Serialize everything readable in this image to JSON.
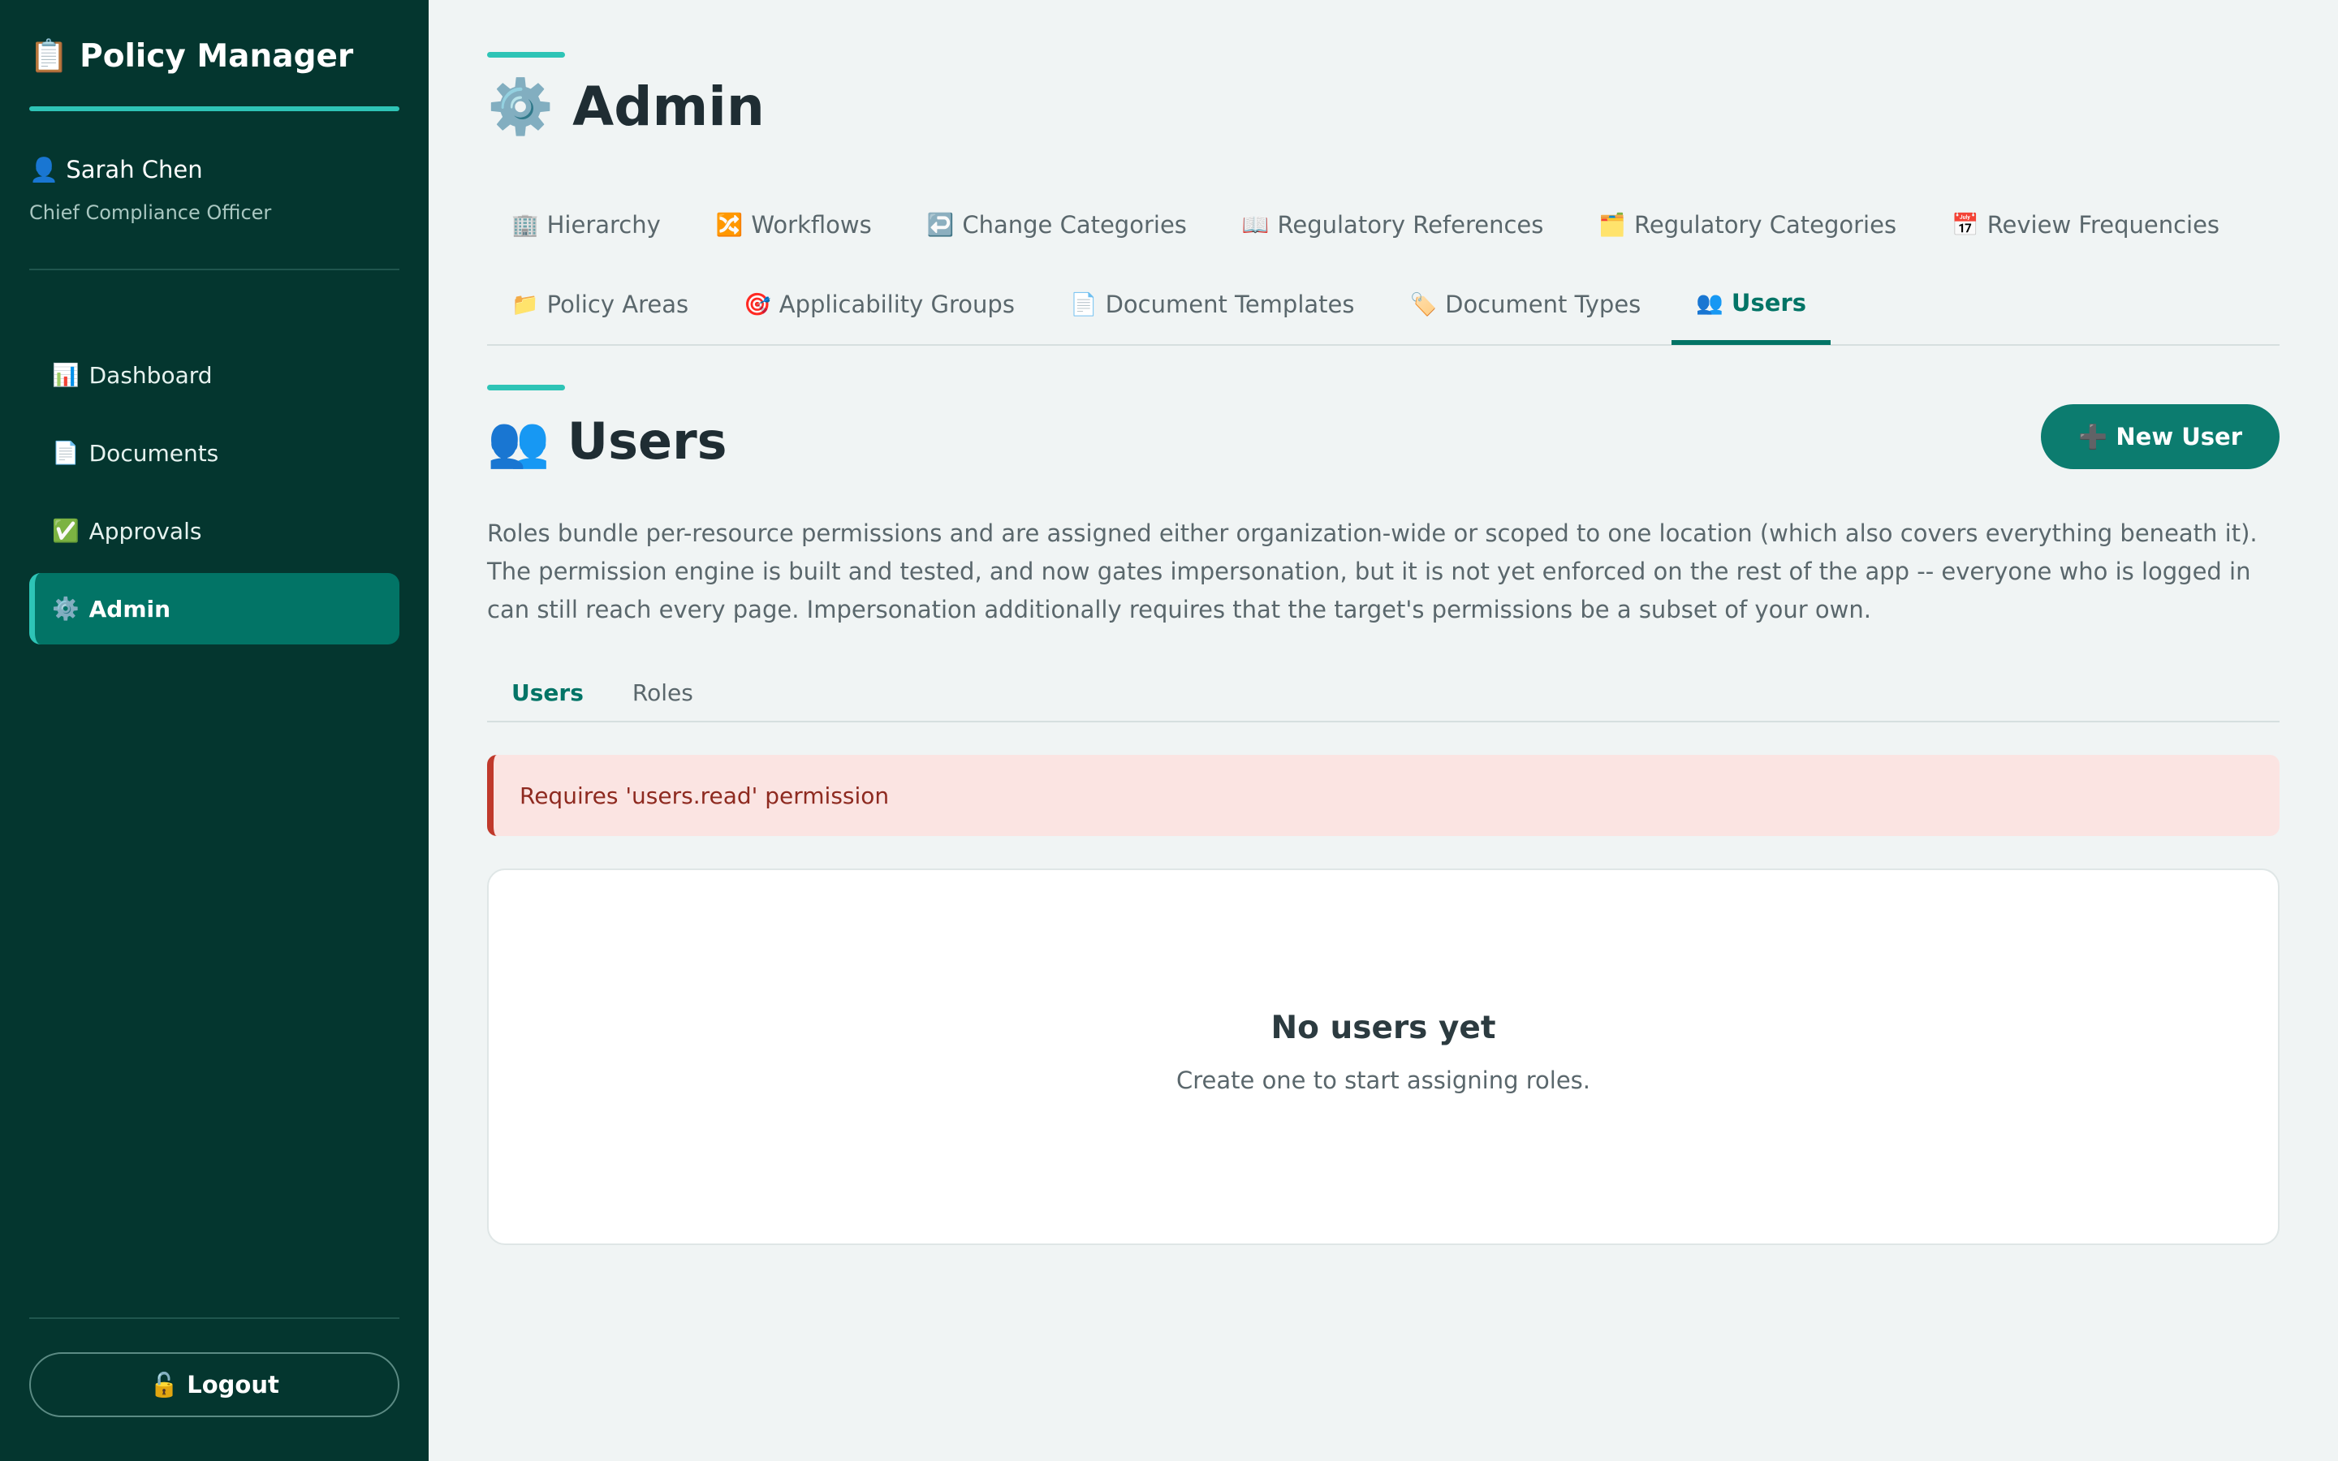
{
  "sidebar": {
    "brand_icon": "📋",
    "brand": "Policy Manager",
    "user_icon": "👤",
    "user_name": "Sarah Chen",
    "user_role": "Chief Compliance Officer",
    "nav": [
      {
        "icon": "📊",
        "icon_name": "dashboard-icon",
        "label": "Dashboard",
        "active": false
      },
      {
        "icon": "📄",
        "icon_name": "documents-icon",
        "label": "Documents",
        "active": false
      },
      {
        "icon": "✅",
        "icon_name": "approvals-icon",
        "label": "Approvals",
        "active": false
      },
      {
        "icon": "⚙️",
        "icon_name": "gear-icon",
        "label": "Admin",
        "active": true
      }
    ],
    "logout_icon": "🔓",
    "logout_label": "Logout"
  },
  "header": {
    "title_icon": "⚙️",
    "title": "Admin"
  },
  "tabs": {
    "row1": [
      {
        "icon": "🏢",
        "icon_name": "building-icon",
        "label": "Hierarchy"
      },
      {
        "icon": "🔀",
        "icon_name": "shuffle-icon",
        "label": "Workflows"
      },
      {
        "icon": "↩️",
        "icon_name": "return-arrow-icon",
        "label": "Change Categories"
      },
      {
        "icon": "📖",
        "icon_name": "book-icon",
        "label": "Regulatory References"
      },
      {
        "icon": "🗂️",
        "icon_name": "card-index-icon",
        "label": "Regulatory Categories"
      },
      {
        "icon": "📅",
        "icon_name": "calendar-icon",
        "label": "Review Frequencies"
      }
    ],
    "row2": [
      {
        "icon": "📁",
        "icon_name": "folder-icon",
        "label": "Policy Areas"
      },
      {
        "icon": "🎯",
        "icon_name": "target-icon",
        "label": "Applicability Groups"
      },
      {
        "icon": "📄",
        "icon_name": "page-icon",
        "label": "Document Templates"
      },
      {
        "icon": "🏷️",
        "icon_name": "tag-icon",
        "label": "Document Types"
      },
      {
        "icon": "👥",
        "icon_name": "users-icon",
        "label": "Users",
        "active": true
      }
    ]
  },
  "section": {
    "icon": "👥",
    "title": "Users",
    "new_button_icon": "➕",
    "new_button_label": "New User",
    "description": "Roles bundle per-resource permissions and are assigned either organization-wide or scoped to one location (which also covers everything beneath it). The permission engine is built and tested, and now gates impersonation, but it is not yet enforced on the rest of the app -- everyone who is logged in can still reach every page. Impersonation additionally requires that the target's permissions be a subset of your own."
  },
  "subtabs": [
    {
      "label": "Users",
      "active": true
    },
    {
      "label": "Roles",
      "active": false
    }
  ],
  "alert": {
    "text": "Requires 'users.read' permission"
  },
  "empty_state": {
    "title": "No users yet",
    "subtitle": "Create one to start assigning roles."
  },
  "colors": {
    "sidebar_bg": "#04362f",
    "accent": "#2ec4b6",
    "primary": "#027466",
    "alert_bg": "#fbe4e2",
    "alert_border": "#c0392b"
  }
}
